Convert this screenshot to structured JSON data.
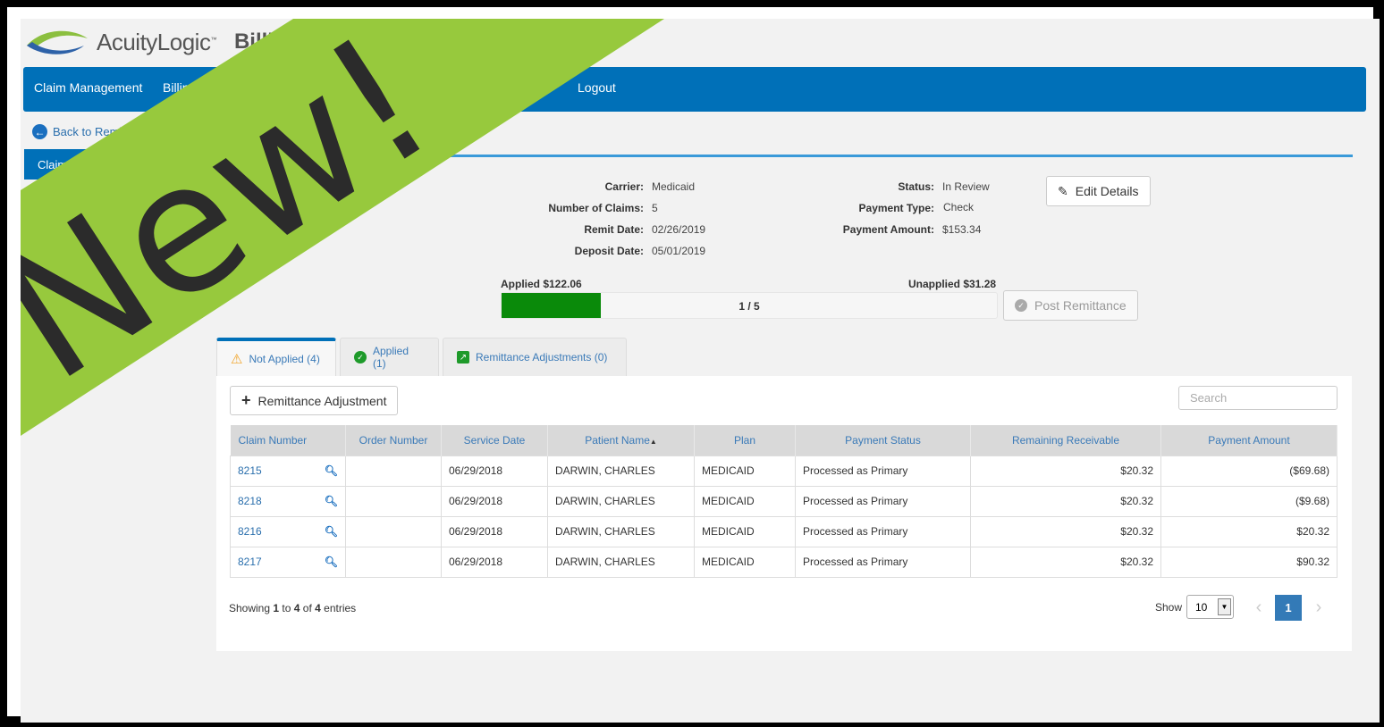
{
  "header": {
    "brand": "AcuityLogic",
    "brand_tm": "™",
    "product": "Billing"
  },
  "nav": {
    "items": [
      "Claim Management",
      "Billing",
      "Logout"
    ]
  },
  "back_link": "Back to Remittances",
  "side_tab": "Claims",
  "summary": {
    "carrier_label": "Carrier:",
    "carrier": "Medicaid",
    "num_claims_label": "Number of Claims:",
    "num_claims": "5",
    "remit_date_label": "Remit Date:",
    "remit_date": "02/26/2019",
    "deposit_date_label": "Deposit Date:",
    "deposit_date": "05/01/2019",
    "status_label": "Status:",
    "status": "In Review",
    "payment_type_label": "Payment Type:",
    "payment_type": "Check",
    "payment_amount_label": "Payment Amount:",
    "payment_amount": "$153.34",
    "edit_button": "Edit Details"
  },
  "progress": {
    "applied": "Applied $122.06",
    "unapplied": "Unapplied $31.28",
    "label": "1 / 5",
    "fraction": 0.2,
    "color": "#0a8a0a"
  },
  "post_button": "Post Remittance",
  "tabs": [
    {
      "label": "Not Applied (4)",
      "icon": "warning-icon"
    },
    {
      "label": "Applied (1)",
      "icon": "check-circle-icon"
    },
    {
      "label": "Remittance Adjustments (0)",
      "icon": "external-arrow-icon"
    }
  ],
  "add_button": "Remittance Adjustment",
  "search_placeholder": "Search",
  "table": {
    "columns": [
      "Claim Number",
      "Order Number",
      "Service Date",
      "Patient Name",
      "Plan",
      "Payment Status",
      "Remaining Receivable",
      "Payment Amount"
    ],
    "sort_indicator": "▲",
    "rows": [
      [
        "8215",
        "",
        "06/29/2018",
        "DARWIN, CHARLES",
        "MEDICAID",
        "Processed as Primary",
        "$20.32",
        "($69.68)"
      ],
      [
        "8218",
        "",
        "06/29/2018",
        "DARWIN, CHARLES",
        "MEDICAID",
        "Processed as Primary",
        "$20.32",
        "($9.68)"
      ],
      [
        "8216",
        "",
        "06/29/2018",
        "DARWIN, CHARLES",
        "MEDICAID",
        "Processed as Primary",
        "$20.32",
        "$20.32"
      ],
      [
        "8217",
        "",
        "06/29/2018",
        "DARWIN, CHARLES",
        "MEDICAID",
        "Processed as Primary",
        "$20.32",
        "$90.32"
      ]
    ]
  },
  "footer": {
    "showing_prefix": "Showing ",
    "from": "1",
    "to_word": " to ",
    "to": "4",
    "of_word": " of ",
    "total": "4",
    "suffix": " entries",
    "show_label": "Show",
    "page_size": "10",
    "page": "1",
    "prev": "‹",
    "next": "›"
  },
  "banner": {
    "text": "New!",
    "color": "#97c93d",
    "text_color": "#2b2b2b"
  }
}
